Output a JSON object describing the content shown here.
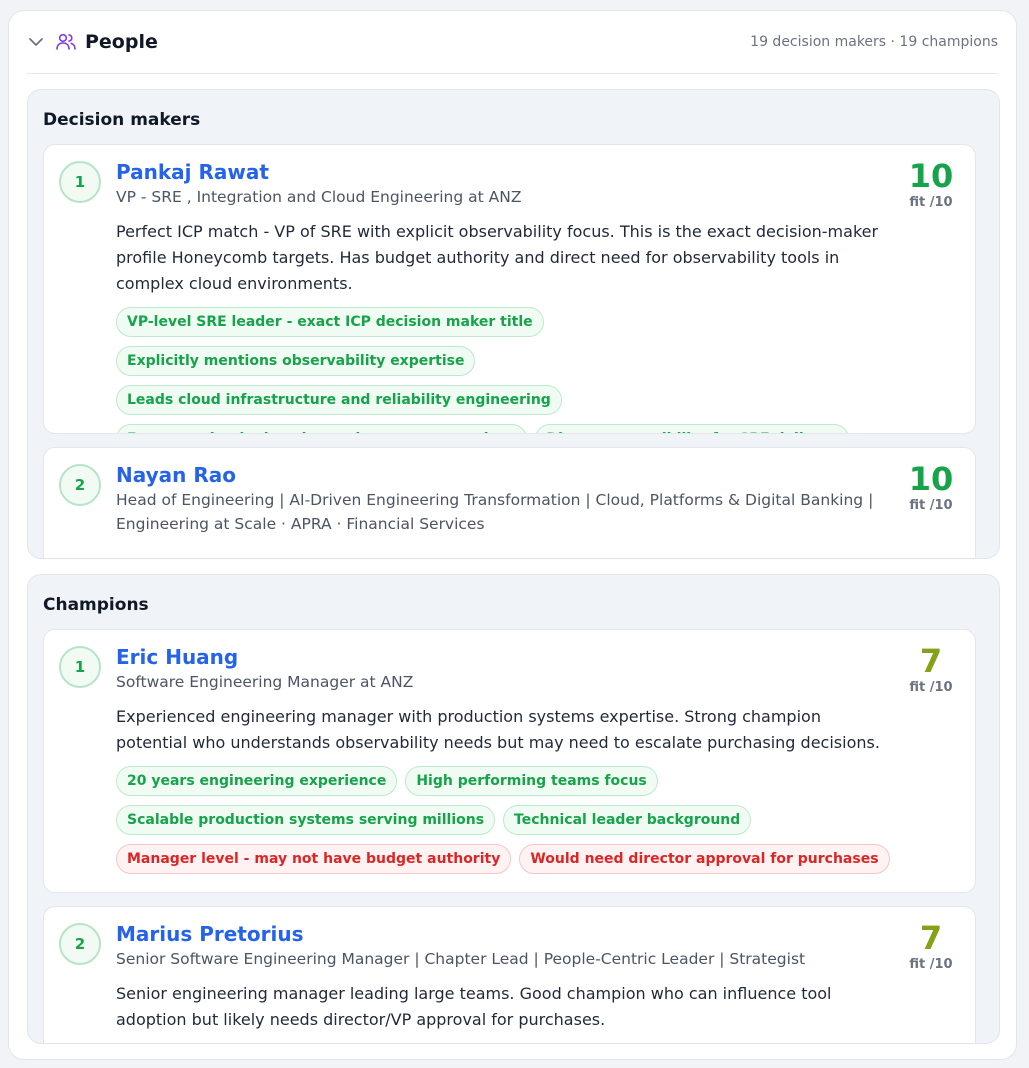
{
  "header": {
    "title": "People",
    "meta": "19 decision makers · 19 champions",
    "chevron_icon": "chevron-down-icon",
    "people_icon": "users-icon",
    "icon_color": "#7c3aed"
  },
  "colors": {
    "name": "#2563eb",
    "score_high": "#16a34a",
    "score_mid": "#84a218",
    "positive_tag": "#16a34a",
    "negative_tag": "#dc2626"
  },
  "decision_makers": {
    "title": "Decision makers",
    "people": [
      {
        "rank": "1",
        "name": "Pankaj Rawat",
        "subtitle": "VP - SRE , Integration and Cloud Engineering at ANZ",
        "summary": "Perfect ICP match - VP of SRE with explicit observability focus. This is the exact decision-maker profile Honeycomb targets. Has budget authority and direct need for observability tools in complex cloud environments.",
        "score": "10",
        "fit": "fit /10",
        "tags": [
          {
            "text": "VP-level SRE leader - exact ICP decision maker title",
            "type": "positive"
          },
          {
            "text": "Explicitly mentions observability expertise",
            "type": "positive"
          },
          {
            "text": "Leads cloud infrastructure and reliability engineering",
            "type": "positive"
          },
          {
            "text": "Focus on cloud migration and support operations",
            "type": "positive"
          },
          {
            "text": "Direct responsibility for SRE delivery",
            "type": "positive"
          }
        ]
      },
      {
        "rank": "2",
        "name": "Nayan Rao",
        "subtitle": "Head of Engineering | AI-Driven Engineering Transformation | Cloud, Platforms & Digital Banking | Engineering at Scale · APRA · Financial Services",
        "score": "10",
        "fit": "fit /10"
      }
    ]
  },
  "champions": {
    "title": "Champions",
    "people": [
      {
        "rank": "1",
        "name": "Eric Huang",
        "subtitle": "Software Engineering Manager at ANZ",
        "summary": "Experienced engineering manager with production systems expertise. Strong champion potential who understands observability needs but may need to escalate purchasing decisions.",
        "score": "7",
        "fit": "fit /10",
        "tags": [
          {
            "text": "20 years engineering experience",
            "type": "positive"
          },
          {
            "text": "High performing teams focus",
            "type": "positive"
          },
          {
            "text": "Scalable production systems serving millions",
            "type": "positive"
          },
          {
            "text": "Technical leader background",
            "type": "positive"
          },
          {
            "text": "Manager level - may not have budget authority",
            "type": "negative"
          },
          {
            "text": "Would need director approval for purchases",
            "type": "negative"
          }
        ]
      },
      {
        "rank": "2",
        "name": "Marius Pretorius",
        "subtitle": "Senior Software Engineering Manager | Chapter Lead | People-Centric Leader | Strategist",
        "summary": "Senior engineering manager leading large teams. Good champion who can influence tool adoption but likely needs director/VP approval for purchases.",
        "score": "7",
        "fit": "fit /10"
      }
    ]
  }
}
